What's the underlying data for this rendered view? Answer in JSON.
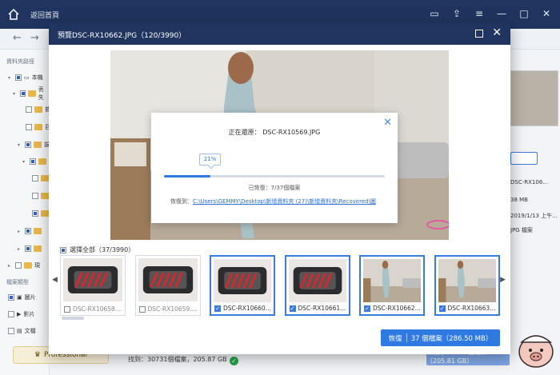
{
  "app": {
    "back_label": "返回首頁",
    "tree_label": "資料夾路徑",
    "type_label": "檔案類型",
    "tree_items": [
      "本機",
      "丟失",
      "普",
      "目",
      "拔",
      "",
      "",
      "",
      "",
      "",
      "",
      "現"
    ],
    "type_items": [
      "圖片",
      "影片",
      "文檔"
    ],
    "pro_label": "Professional",
    "footer_line1": "找到：30731個檔案，205.87 GB",
    "bg_recover_label": "恢復 | 30525 個檔案（205.81 GB）",
    "right_info": [
      "DSC-RX106...",
      "38 MB",
      "2019/1/13 上午...",
      "JPG 檔案"
    ]
  },
  "preview": {
    "title": "預覽DSC-RX10662.JPG（120/3990）",
    "select_all_label": "選擇全部（37/3990）",
    "thumbnails": [
      {
        "name": "DSC-RX10658....",
        "selected": false,
        "dim": true,
        "kind": "vacuum"
      },
      {
        "name": "DSC-RX10659....",
        "selected": false,
        "dim": true,
        "kind": "vacuum"
      },
      {
        "name": "DSC-RX10660....",
        "selected": true,
        "dim": false,
        "kind": "vacuum"
      },
      {
        "name": "DSC-RX10661....",
        "selected": true,
        "dim": false,
        "kind": "vacuum"
      },
      {
        "name": "DSC-RX10662....",
        "selected": true,
        "dim": false,
        "kind": "room"
      },
      {
        "name": "DSC-RX10663....",
        "selected": true,
        "dim": false,
        "kind": "room"
      }
    ],
    "recover_label": "恢復",
    "recover_detail": "37 個檔案（286.50 MB）"
  },
  "progress": {
    "status_prefix": "正在還原：",
    "current_file": "DSC-RX10569.JPG",
    "percent_label": "21%",
    "percent": 0.21,
    "count_text": "已恢復：7/37個檔案",
    "path_label": "恢復到：",
    "path": "C:\\Users\\GEMMY\\Desktop\\新增資料夾 (27)\\新增資料夾\\Recovered\\圖"
  }
}
